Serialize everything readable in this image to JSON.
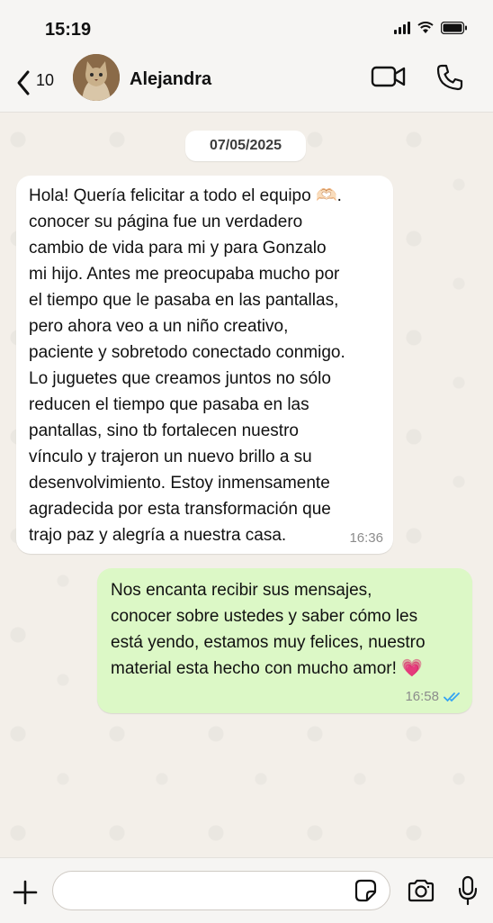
{
  "status_bar": {
    "time": "15:19"
  },
  "header": {
    "back_count": "10",
    "contact_name": "Alejandra"
  },
  "chat": {
    "date_label": "07/05/2025",
    "messages": [
      {
        "direction": "incoming",
        "lines": [
          "Hola! Quería felicitar a todo el equipo 🫶🏻.",
          "conocer su página fue un verdadero",
          "cambio de vida para mi y para Gonzalo",
          "mi hijo. Antes me preocupaba mucho por",
          "el tiempo que le pasaba en las pantallas,",
          "pero ahora veo a un niño creativo,",
          "paciente y sobretodo conectado conmigo.",
          "Lo juguetes que creamos juntos no sólo",
          "reducen el tiempo que pasaba en las",
          "pantallas, sino tb fortalecen nuestro",
          "vínculo y trajeron un nuevo brillo a su",
          "desenvolvimiento. Estoy inmensamente",
          "agradecida por esta transformación que",
          "trajo paz y alegría a nuestra casa."
        ],
        "time": "16:36"
      },
      {
        "direction": "outgoing",
        "lines": [
          "Nos encanta recibir sus mensajes,",
          "conocer sobre ustedes y saber cómo les",
          "está yendo, estamos muy felices, nuestro",
          "material esta hecho con mucho amor! 💗"
        ],
        "time": "16:58",
        "status": "read"
      }
    ]
  },
  "input": {
    "placeholder": "",
    "value": ""
  },
  "colors": {
    "incoming_bubble": "#ffffff",
    "outgoing_bubble": "#dcf8c6",
    "read_ticks": "#34a3f3",
    "chat_background": "#f3efe9"
  },
  "icons": [
    "back-chevron-icon",
    "video-call-icon",
    "phone-icon",
    "plus-icon",
    "sticker-icon",
    "camera-icon",
    "microphone-icon",
    "double-check-icon"
  ]
}
